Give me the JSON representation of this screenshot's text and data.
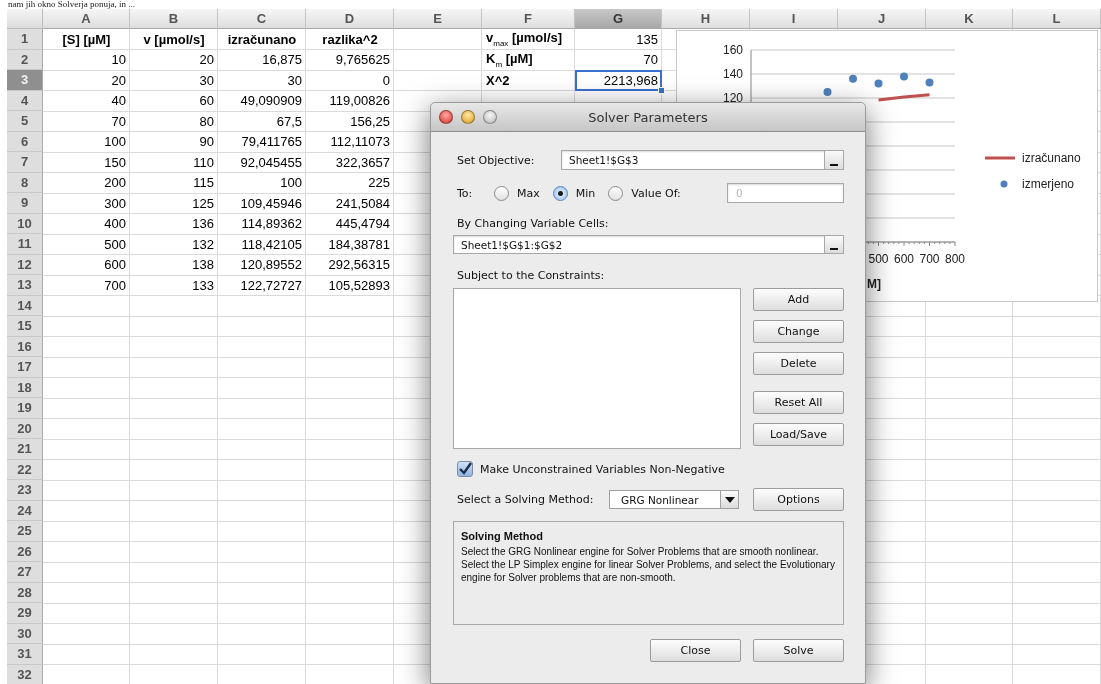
{
  "caption": "nam jih okno Solverja ponuja, in ...",
  "sheet": {
    "columns": [
      {
        "label": "A",
        "selected": false
      },
      {
        "label": "B",
        "selected": false
      },
      {
        "label": "C",
        "selected": false
      },
      {
        "label": "D",
        "selected": false
      },
      {
        "label": "E",
        "selected": false
      },
      {
        "label": "F",
        "selected": false
      },
      {
        "label": "G",
        "selected": true
      },
      {
        "label": "H",
        "selected": false
      },
      {
        "label": "I",
        "selected": false
      },
      {
        "label": "J",
        "selected": false
      },
      {
        "label": "K",
        "selected": false
      },
      {
        "label": "L",
        "selected": false
      }
    ],
    "rows": [
      {
        "number": "1",
        "selected": false,
        "kind": "header",
        "cells": [
          "[S] [µM]",
          "v [µmol/s]",
          "izračunano",
          "razlika^2"
        ],
        "extra": [
          {
            "kind": "label",
            "text": "v$_{max}$ [µmol/s]",
            "active": false
          },
          {
            "kind": "value",
            "text": "135",
            "active": false
          }
        ]
      },
      {
        "number": "2",
        "selected": false,
        "kind": "data",
        "cells": [
          "10",
          "20",
          "16,875",
          "9,765625"
        ],
        "extra": [
          {
            "kind": "label",
            "text": "K$_{m}$ [µM]",
            "active": false
          },
          {
            "kind": "value",
            "text": "70",
            "active": false
          }
        ]
      },
      {
        "number": "3",
        "selected": true,
        "kind": "data",
        "cells": [
          "20",
          "30",
          "30",
          "0"
        ],
        "extra": [
          {
            "kind": "label",
            "text": "X^2",
            "active": false
          },
          {
            "kind": "value",
            "text": "2213,968",
            "active": true
          }
        ]
      },
      {
        "number": "4",
        "selected": false,
        "kind": "data",
        "cells": [
          "40",
          "60",
          "49,090909",
          "119,00826"
        ]
      },
      {
        "number": "5",
        "selected": false,
        "kind": "data",
        "cells": [
          "70",
          "80",
          "67,5",
          "156,25"
        ]
      },
      {
        "number": "6",
        "selected": false,
        "kind": "data",
        "cells": [
          "100",
          "90",
          "79,411765",
          "112,11073"
        ]
      },
      {
        "number": "7",
        "selected": false,
        "kind": "data",
        "cells": [
          "150",
          "110",
          "92,045455",
          "322,3657"
        ]
      },
      {
        "number": "8",
        "selected": false,
        "kind": "data",
        "cells": [
          "200",
          "115",
          "100",
          "225"
        ]
      },
      {
        "number": "9",
        "selected": false,
        "kind": "data",
        "cells": [
          "300",
          "125",
          "109,45946",
          "241,5084"
        ]
      },
      {
        "number": "10",
        "selected": false,
        "kind": "data",
        "cells": [
          "400",
          "136",
          "114,89362",
          "445,4794"
        ]
      },
      {
        "number": "11",
        "selected": false,
        "kind": "data",
        "cells": [
          "500",
          "132",
          "118,42105",
          "184,38781"
        ]
      },
      {
        "number": "12",
        "selected": false,
        "kind": "data",
        "cells": [
          "600",
          "138",
          "120,89552",
          "292,56315"
        ]
      },
      {
        "number": "13",
        "selected": false,
        "kind": "data",
        "cells": [
          "700",
          "133",
          "122,72727",
          "105,52893"
        ]
      },
      {
        "number": "14",
        "selected": false
      },
      {
        "number": "15",
        "selected": false
      },
      {
        "number": "16",
        "selected": false
      },
      {
        "number": "17",
        "selected": false
      },
      {
        "number": "18",
        "selected": false
      },
      {
        "number": "19",
        "selected": false
      },
      {
        "number": "20",
        "selected": false
      },
      {
        "number": "21",
        "selected": false
      },
      {
        "number": "22",
        "selected": false
      },
      {
        "number": "23",
        "selected": false
      },
      {
        "number": "24",
        "selected": false
      },
      {
        "number": "25",
        "selected": false
      },
      {
        "number": "26",
        "selected": false
      },
      {
        "number": "27",
        "selected": false
      },
      {
        "number": "28",
        "selected": false
      },
      {
        "number": "29",
        "selected": false
      },
      {
        "number": "30",
        "selected": false
      },
      {
        "number": "31",
        "selected": false
      },
      {
        "number": "32",
        "selected": false
      }
    ]
  },
  "chart": {
    "layers": [
      {
        "chart_data": {
          "type": "line",
          "xlabel": "M]",
          "x": [
            500,
            600,
            700
          ],
          "xlim": [
            0,
            800
          ],
          "ylim": [
            0,
            160
          ],
          "xticks": [
            500,
            600,
            700,
            800
          ],
          "yticks": [
            120,
            140,
            160
          ],
          "series": [
            {
              "name": "izračunano",
              "color": "#c0504d",
              "values": [
                118.4,
                120.9,
                122.7
              ]
            }
          ]
        }
      },
      {
        "chart_data": {
          "type": "scatter",
          "x": [
            300,
            400,
            500,
            600,
            700
          ],
          "xlim": [
            0,
            800
          ],
          "ylim": [
            0,
            160
          ],
          "series": [
            {
              "name": "izmerjeno",
              "color": "#4f81bd",
              "values": [
                125,
                136,
                132,
                138,
                133
              ]
            }
          ]
        }
      }
    ]
  },
  "dialog": {
    "title": "Solver Parameters",
    "objective": {
      "label": "Set Objective:",
      "value": "Sheet1!$G$3"
    },
    "to": {
      "label": "To:",
      "options": [
        {
          "label": "Max",
          "selected": false
        },
        {
          "label": "Min",
          "selected": true
        },
        {
          "label": "Value Of:",
          "selected": false
        }
      ],
      "value_field": {
        "value": "0",
        "disabled": true
      }
    },
    "changing": {
      "label": "By Changing Variable Cells:",
      "value": "Sheet1!$G$1:$G$2"
    },
    "constraints": {
      "label": "Subject to the Constraints:",
      "buttons": [
        "Add",
        "Change",
        "Delete",
        "Reset All",
        "Load/Save"
      ]
    },
    "non_negative": {
      "label": "Make Unconstrained Variables Non-Negative",
      "checked": true
    },
    "method": {
      "label": "Select a Solving Method:",
      "value": "GRG Nonlinear",
      "options_button": "Options"
    },
    "description": {
      "title": "Solving Method",
      "text": "Select the GRG Nonlinear engine for Solver Problems that are smooth nonlinear. Select the LP Simplex engine for linear Solver Problems, and select the Evolutionary engine for Solver problems that are non-smooth."
    },
    "footer_buttons": [
      "Close",
      "Solve"
    ]
  }
}
